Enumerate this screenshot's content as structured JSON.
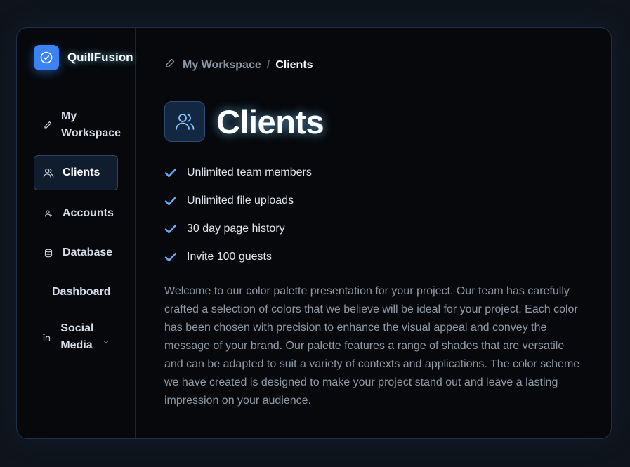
{
  "brand": {
    "name": "QuillFusion"
  },
  "sidebar": {
    "items": [
      {
        "label": "My Workspace",
        "icon": "pencil-icon"
      },
      {
        "label": "Clients",
        "icon": "users-icon",
        "active": true
      },
      {
        "label": "Accounts",
        "icon": "user-icon"
      },
      {
        "label": "Database",
        "icon": "database-icon"
      },
      {
        "label": "Dashboard",
        "icon": ""
      },
      {
        "label": "Social Media",
        "icon": "linkedin-icon",
        "has_submenu": true
      }
    ]
  },
  "breadcrumb": {
    "parent": "My Workspace",
    "separator": "/",
    "current": "Clients"
  },
  "page": {
    "title": "Clients",
    "features": [
      "Unlimited team members",
      "Unlimited file uploads",
      "30 day page history",
      "Invite 100 guests"
    ],
    "description": "Welcome to our color palette presentation for your project. Our team has carefully crafted a selection of colors that we believe will be ideal for your project. Each color has been chosen with precision to enhance the visual appeal and convey the message of your brand. Our palette features a range of shades that are versatile and can be adapted to suit a variety of contexts and applications. The color scheme we have created is designed to make your project stand out and leave a lasting impression on your audience."
  },
  "colors": {
    "accent": "#3b82f6",
    "background": "#06080b",
    "border": "#1c3048"
  }
}
